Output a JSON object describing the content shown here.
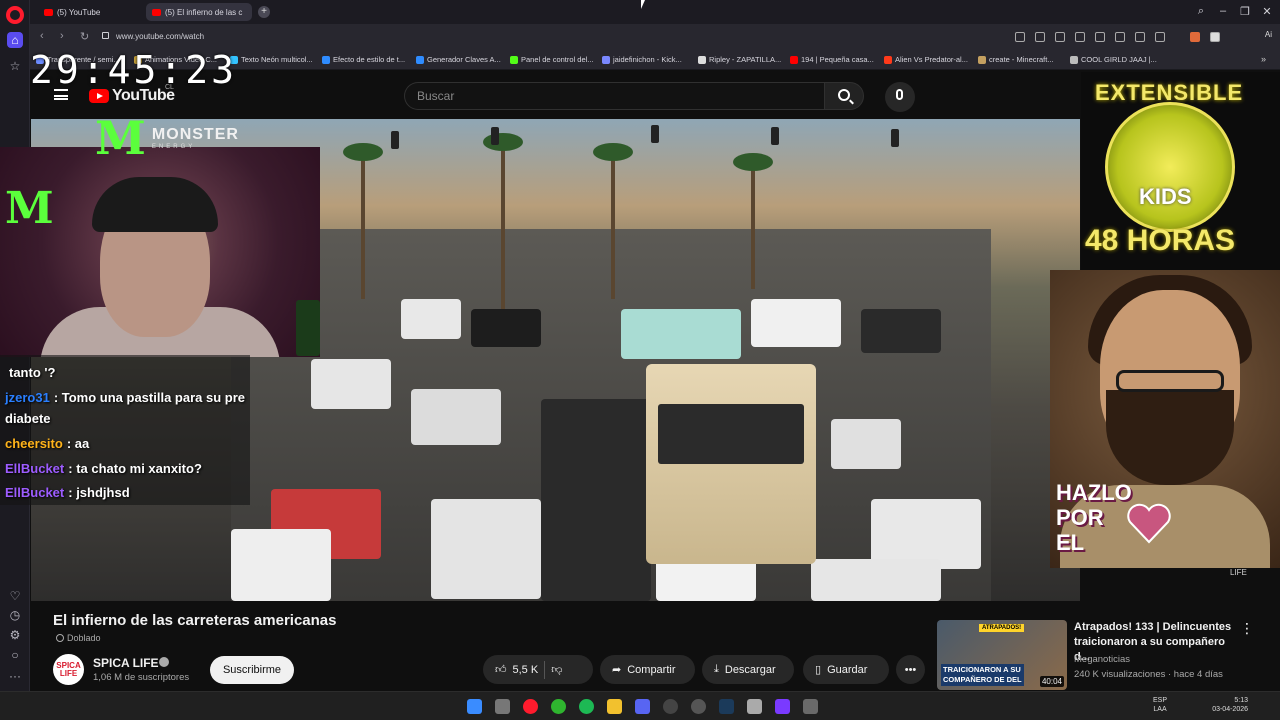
{
  "browser": {
    "tabs": [
      {
        "label": "(5) YouTube"
      },
      {
        "label": "(5) El infierno de las c"
      }
    ],
    "url": "www.youtube.com/watch",
    "ai_label": "Ai",
    "bookmarks": [
      {
        "label": "Transparente / semi...",
        "color": "#6c8cff"
      },
      {
        "label": "Animations Video C...",
        "color": "#c9a33a"
      },
      {
        "label": "Texto Neón multicol...",
        "color": "#34c3ff"
      },
      {
        "label": "Efecto de estilo de t...",
        "color": "#2f8cff"
      },
      {
        "label": "Generador Claves A...",
        "color": "#2f8cff"
      },
      {
        "label": "Panel de control del...",
        "color": "#53fc18"
      },
      {
        "label": "jaidefinichon - Kick...",
        "color": "#7a88ff"
      },
      {
        "label": "Ripley - ZAPATILLA...",
        "color": "#dddddd"
      },
      {
        "label": "194 | Pequeña casa...",
        "color": "#ff0000"
      },
      {
        "label": "Alien Vs Predator-al...",
        "color": "#ff3a1a"
      },
      {
        "label": "create - Minecraft...",
        "color": "#c4a060"
      },
      {
        "label": "COOL GIRLD JAAJ |...",
        "color": "#bbbbbb"
      }
    ]
  },
  "overlay": {
    "clock": "29:45:23",
    "monster_brand": "MONSTER",
    "monster_sub": "ENERGY",
    "extensible": "EXTENSIBLE",
    "kids": "KIDS",
    "hours": "48 HORAS",
    "hazlo": [
      "HAZLO",
      "POR",
      "EL"
    ],
    "watermark": "LIFE"
  },
  "chat": [
    {
      "user": "",
      "message": "tanto '?",
      "color": "#ffffff"
    },
    {
      "user": "jzero31",
      "message": ": Tomo una pastilla para su pre",
      "color": "#2a7fff"
    },
    {
      "user": "",
      "message": "diabete",
      "color": "#ffffff"
    },
    {
      "user": "cheersito",
      "message": ": aa",
      "color": "#ffb31a"
    },
    {
      "user": "EllBucket",
      "message": ": ta chato mi xanxito?",
      "color": "#9d5cff"
    },
    {
      "user": "EllBucket",
      "message": ": jshdjhsd",
      "color": "#9d5cff"
    }
  ],
  "youtube": {
    "logo": "YouTube",
    "country": "CL",
    "search_placeholder": "Buscar",
    "video_title": "El infierno de las carreteras americanas",
    "dubbed": "Doblado",
    "channel": {
      "name": "SPICA LIFE",
      "avatar_text": "SPICA LIFE",
      "subscribers": "1,06 M de suscriptores",
      "subscribe_label": "Suscribirme"
    },
    "actions": {
      "likes": "5,5 K",
      "share": "Compartir",
      "download": "Descargar",
      "save": "Guardar",
      "more": "•••"
    },
    "recommended": {
      "badge": "ATRAPADOS!",
      "caption_1": "TRAICIONARON A SU",
      "caption_2": "COMPAÑERO DE DEL",
      "duration": "40:04",
      "title": "Atrapados! 133 | Delincuentes traicionaron a su compañero d...",
      "channel": "Meganoticias",
      "meta": "240 K visualizaciones · hace 4 días"
    }
  },
  "taskbar": {
    "lang_1": "ESP",
    "lang_2": "LAA",
    "time": "5:13",
    "date": "03-04-2026"
  }
}
